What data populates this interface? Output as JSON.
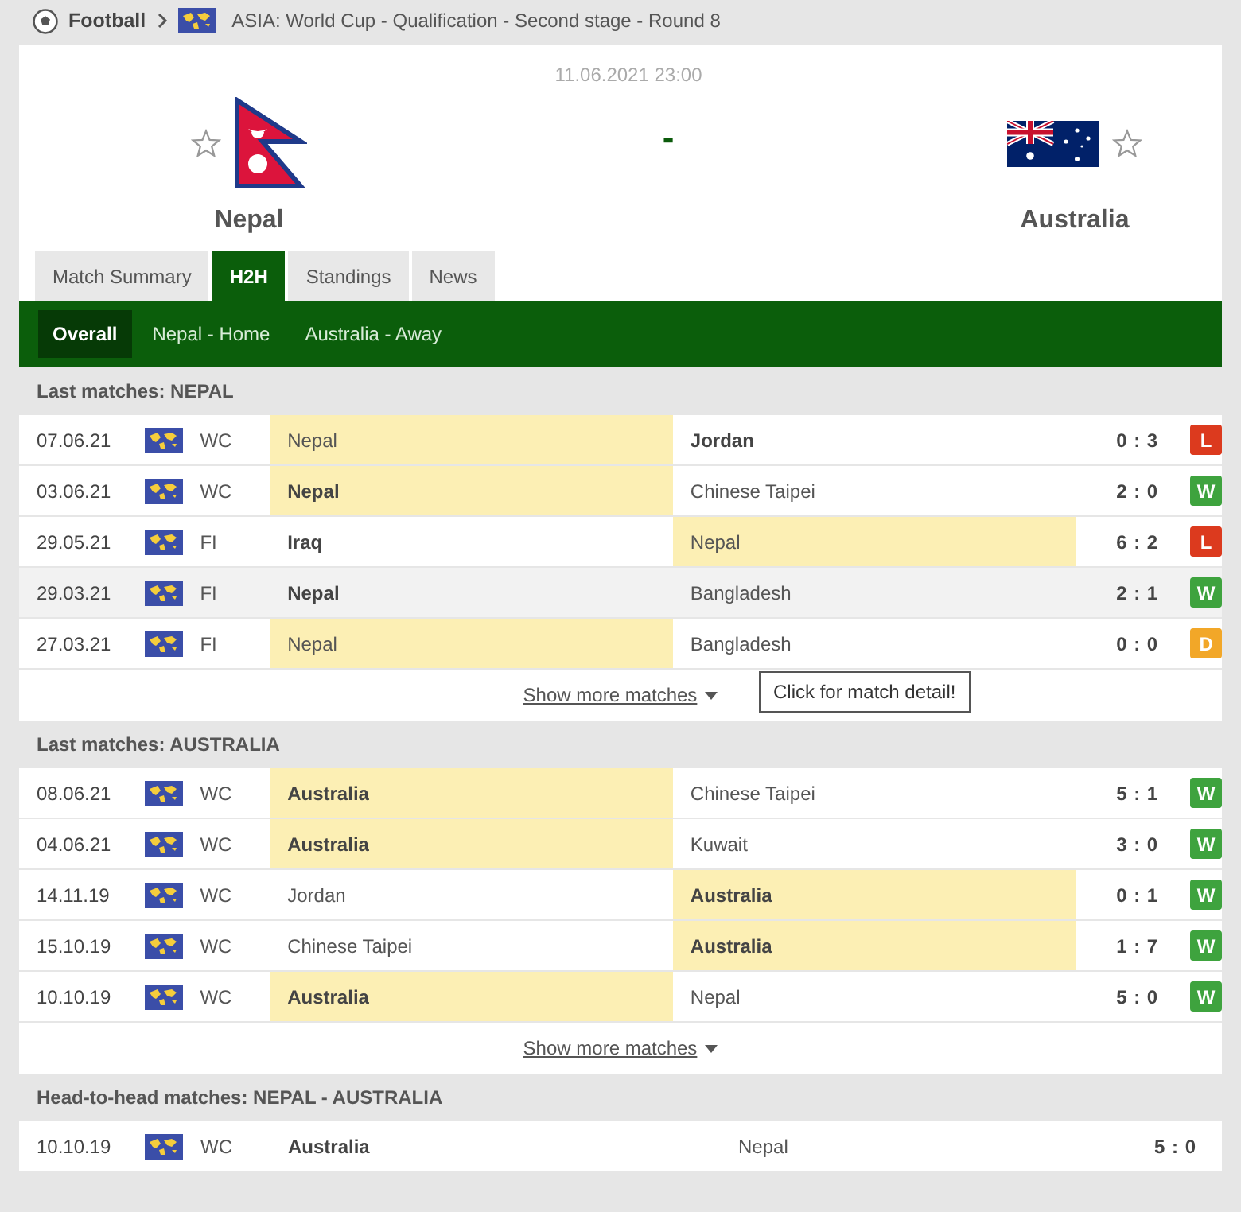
{
  "breadcrumb": {
    "sport": "Football",
    "competition": "ASIA: World Cup - Qualification - Second stage - Round 8"
  },
  "match": {
    "datetime": "11.06.2021 23:00",
    "home": {
      "name": "Nepal",
      "kind": "nepal",
      "favorite": false
    },
    "away": {
      "name": "Australia",
      "kind": "australia",
      "favorite": false
    },
    "score": "-"
  },
  "tabs": [
    {
      "label": "Match Summary",
      "selected": false
    },
    {
      "label": "H2H",
      "selected": true
    },
    {
      "label": "Standings",
      "selected": false
    },
    {
      "label": "News",
      "selected": false
    }
  ],
  "subtabs": [
    {
      "label": "Overall",
      "selected": true
    },
    {
      "label": "Nepal - Home",
      "selected": false
    },
    {
      "label": "Australia - Away",
      "selected": false
    }
  ],
  "sections": [
    {
      "title": "Last matches: NEPAL",
      "kind": "form",
      "rows": [
        {
          "date": "07.06.21",
          "competition": "WC",
          "home": "Nepal",
          "away": "Jordan",
          "home_bold": false,
          "away_bold": true,
          "home_highlighted": true,
          "away_highlighted": false,
          "hovered": false,
          "score": "0 : 3",
          "result": "L"
        },
        {
          "date": "03.06.21",
          "competition": "WC",
          "home": "Nepal",
          "away": "Chinese Taipei",
          "home_bold": true,
          "away_bold": false,
          "home_highlighted": true,
          "away_highlighted": false,
          "hovered": false,
          "score": "2 : 0",
          "result": "W"
        },
        {
          "date": "29.05.21",
          "competition": "FI",
          "home": "Iraq",
          "away": "Nepal",
          "home_bold": true,
          "away_bold": false,
          "home_highlighted": false,
          "away_highlighted": true,
          "hovered": false,
          "score": "6 : 2",
          "result": "L"
        },
        {
          "date": "29.03.21",
          "competition": "FI",
          "home": "Nepal",
          "away": "Bangladesh",
          "home_bold": true,
          "away_bold": false,
          "home_highlighted": false,
          "away_highlighted": false,
          "hovered": true,
          "score": "2 : 1",
          "result": "W"
        },
        {
          "date": "27.03.21",
          "competition": "FI",
          "home": "Nepal",
          "away": "Bangladesh",
          "home_bold": false,
          "away_bold": false,
          "home_highlighted": true,
          "away_highlighted": false,
          "hovered": false,
          "score": "0 : 0",
          "result": "D"
        }
      ],
      "tooltip": "Click for match detail!",
      "more": "Show more matches"
    },
    {
      "title": "Last matches: AUSTRALIA",
      "kind": "form",
      "rows": [
        {
          "date": "08.06.21",
          "competition": "WC",
          "home": "Australia",
          "away": "Chinese Taipei",
          "home_bold": true,
          "away_bold": false,
          "home_highlighted": true,
          "away_highlighted": false,
          "hovered": false,
          "score": "5 : 1",
          "result": "W"
        },
        {
          "date": "04.06.21",
          "competition": "WC",
          "home": "Australia",
          "away": "Kuwait",
          "home_bold": true,
          "away_bold": false,
          "home_highlighted": true,
          "away_highlighted": false,
          "hovered": false,
          "score": "3 : 0",
          "result": "W"
        },
        {
          "date": "14.11.19",
          "competition": "WC",
          "home": "Jordan",
          "away": "Australia",
          "home_bold": false,
          "away_bold": true,
          "home_highlighted": false,
          "away_highlighted": true,
          "hovered": false,
          "score": "0 : 1",
          "result": "W"
        },
        {
          "date": "15.10.19",
          "competition": "WC",
          "home": "Chinese Taipei",
          "away": "Australia",
          "home_bold": false,
          "away_bold": true,
          "home_highlighted": false,
          "away_highlighted": true,
          "hovered": false,
          "score": "1 : 7",
          "result": "W"
        },
        {
          "date": "10.10.19",
          "competition": "WC",
          "home": "Australia",
          "away": "Nepal",
          "home_bold": true,
          "away_bold": false,
          "home_highlighted": true,
          "away_highlighted": false,
          "hovered": false,
          "score": "5 : 0",
          "result": "W"
        }
      ],
      "more": "Show more matches"
    },
    {
      "title": "Head-to-head matches: NEPAL - AUSTRALIA",
      "kind": "h2h",
      "rows": [
        {
          "date": "10.10.19",
          "competition": "WC",
          "home": "Australia",
          "away": "Nepal",
          "home_bold": true,
          "away_bold": false,
          "home_highlighted": false,
          "away_highlighted": false,
          "hovered": false,
          "score": "5 : 0"
        }
      ]
    }
  ]
}
